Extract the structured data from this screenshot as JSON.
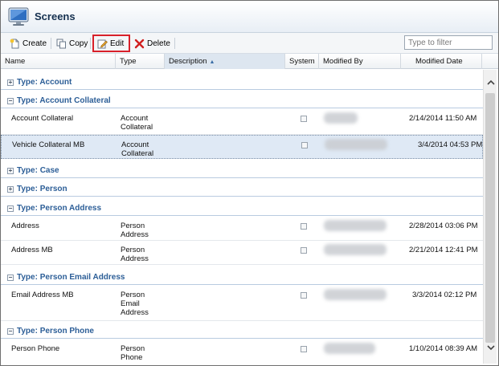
{
  "window": {
    "title": "Screens"
  },
  "toolbar": {
    "create_label": "Create",
    "copy_label": "Copy",
    "edit_label": "Edit",
    "delete_label": "Delete",
    "filter_placeholder": "Type to filter",
    "highlight_color": "#d8202a"
  },
  "columns": {
    "name": "Name",
    "type": "Type",
    "description": "Description",
    "system": "System",
    "modified_by": "Modified By",
    "modified_date": "Modified Date"
  },
  "groups": {
    "account": "Type: Account",
    "account_collateral": "Type: Account Collateral",
    "case": "Type: Case",
    "person": "Type: Person",
    "person_address": "Type: Person Address",
    "person_email": "Type: Person Email Address",
    "person_phone": "Type: Person Phone"
  },
  "rows": [
    {
      "name": "Account Collateral",
      "type_l1": "Account",
      "type_l2": "Collateral",
      "type_l3": "",
      "date": "2/14/2014 11:50 AM"
    },
    {
      "name": "Vehicle Collateral MB",
      "type_l1": "Account",
      "type_l2": "Collateral",
      "type_l3": "",
      "date": "3/4/2014 04:53 PM"
    },
    {
      "name": "Address",
      "type_l1": "Person",
      "type_l2": "Address",
      "type_l3": "",
      "date": "2/28/2014 03:06 PM"
    },
    {
      "name": "Address MB",
      "type_l1": "Person",
      "type_l2": "Address",
      "type_l3": "",
      "date": "2/21/2014 12:41 PM"
    },
    {
      "name": "Email Address MB",
      "type_l1": "Person",
      "type_l2": "Email",
      "type_l3": "Address",
      "date": "3/3/2014 02:12 PM"
    },
    {
      "name": "Person Phone",
      "type_l1": "Person",
      "type_l2": "Phone",
      "type_l3": "",
      "date": "1/10/2014 08:39 AM"
    }
  ],
  "icons": {
    "app": "monitor-icon",
    "create": "new-document-icon",
    "copy": "copy-icon",
    "edit": "edit-icon",
    "delete": "delete-x-icon",
    "scroll_up": "chevron-up-icon",
    "scroll_down": "chevron-down-icon"
  }
}
